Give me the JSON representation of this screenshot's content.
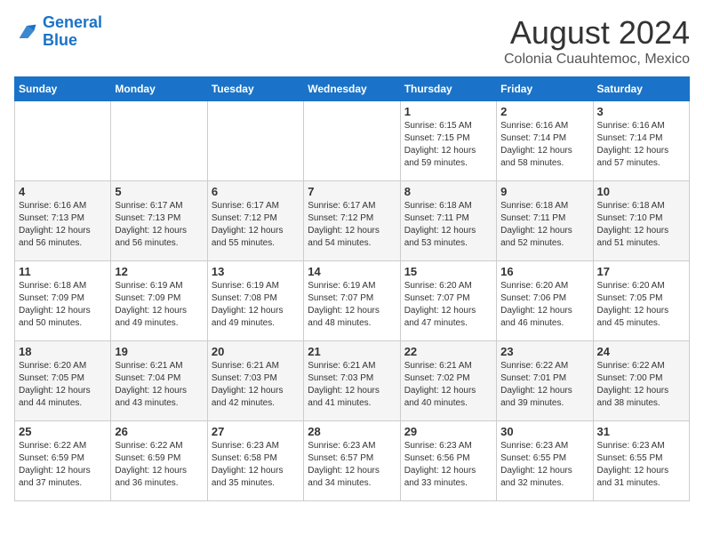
{
  "logo": {
    "line1": "General",
    "line2": "Blue"
  },
  "title": "August 2024",
  "subtitle": "Colonia Cuauhtemoc, Mexico",
  "days_of_week": [
    "Sunday",
    "Monday",
    "Tuesday",
    "Wednesday",
    "Thursday",
    "Friday",
    "Saturday"
  ],
  "weeks": [
    [
      {
        "day": "",
        "info": ""
      },
      {
        "day": "",
        "info": ""
      },
      {
        "day": "",
        "info": ""
      },
      {
        "day": "",
        "info": ""
      },
      {
        "day": "1",
        "info": "Sunrise: 6:15 AM\nSunset: 7:15 PM\nDaylight: 12 hours\nand 59 minutes."
      },
      {
        "day": "2",
        "info": "Sunrise: 6:16 AM\nSunset: 7:14 PM\nDaylight: 12 hours\nand 58 minutes."
      },
      {
        "day": "3",
        "info": "Sunrise: 6:16 AM\nSunset: 7:14 PM\nDaylight: 12 hours\nand 57 minutes."
      }
    ],
    [
      {
        "day": "4",
        "info": "Sunrise: 6:16 AM\nSunset: 7:13 PM\nDaylight: 12 hours\nand 56 minutes."
      },
      {
        "day": "5",
        "info": "Sunrise: 6:17 AM\nSunset: 7:13 PM\nDaylight: 12 hours\nand 56 minutes."
      },
      {
        "day": "6",
        "info": "Sunrise: 6:17 AM\nSunset: 7:12 PM\nDaylight: 12 hours\nand 55 minutes."
      },
      {
        "day": "7",
        "info": "Sunrise: 6:17 AM\nSunset: 7:12 PM\nDaylight: 12 hours\nand 54 minutes."
      },
      {
        "day": "8",
        "info": "Sunrise: 6:18 AM\nSunset: 7:11 PM\nDaylight: 12 hours\nand 53 minutes."
      },
      {
        "day": "9",
        "info": "Sunrise: 6:18 AM\nSunset: 7:11 PM\nDaylight: 12 hours\nand 52 minutes."
      },
      {
        "day": "10",
        "info": "Sunrise: 6:18 AM\nSunset: 7:10 PM\nDaylight: 12 hours\nand 51 minutes."
      }
    ],
    [
      {
        "day": "11",
        "info": "Sunrise: 6:18 AM\nSunset: 7:09 PM\nDaylight: 12 hours\nand 50 minutes."
      },
      {
        "day": "12",
        "info": "Sunrise: 6:19 AM\nSunset: 7:09 PM\nDaylight: 12 hours\nand 49 minutes."
      },
      {
        "day": "13",
        "info": "Sunrise: 6:19 AM\nSunset: 7:08 PM\nDaylight: 12 hours\nand 49 minutes."
      },
      {
        "day": "14",
        "info": "Sunrise: 6:19 AM\nSunset: 7:07 PM\nDaylight: 12 hours\nand 48 minutes."
      },
      {
        "day": "15",
        "info": "Sunrise: 6:20 AM\nSunset: 7:07 PM\nDaylight: 12 hours\nand 47 minutes."
      },
      {
        "day": "16",
        "info": "Sunrise: 6:20 AM\nSunset: 7:06 PM\nDaylight: 12 hours\nand 46 minutes."
      },
      {
        "day": "17",
        "info": "Sunrise: 6:20 AM\nSunset: 7:05 PM\nDaylight: 12 hours\nand 45 minutes."
      }
    ],
    [
      {
        "day": "18",
        "info": "Sunrise: 6:20 AM\nSunset: 7:05 PM\nDaylight: 12 hours\nand 44 minutes."
      },
      {
        "day": "19",
        "info": "Sunrise: 6:21 AM\nSunset: 7:04 PM\nDaylight: 12 hours\nand 43 minutes."
      },
      {
        "day": "20",
        "info": "Sunrise: 6:21 AM\nSunset: 7:03 PM\nDaylight: 12 hours\nand 42 minutes."
      },
      {
        "day": "21",
        "info": "Sunrise: 6:21 AM\nSunset: 7:03 PM\nDaylight: 12 hours\nand 41 minutes."
      },
      {
        "day": "22",
        "info": "Sunrise: 6:21 AM\nSunset: 7:02 PM\nDaylight: 12 hours\nand 40 minutes."
      },
      {
        "day": "23",
        "info": "Sunrise: 6:22 AM\nSunset: 7:01 PM\nDaylight: 12 hours\nand 39 minutes."
      },
      {
        "day": "24",
        "info": "Sunrise: 6:22 AM\nSunset: 7:00 PM\nDaylight: 12 hours\nand 38 minutes."
      }
    ],
    [
      {
        "day": "25",
        "info": "Sunrise: 6:22 AM\nSunset: 6:59 PM\nDaylight: 12 hours\nand 37 minutes."
      },
      {
        "day": "26",
        "info": "Sunrise: 6:22 AM\nSunset: 6:59 PM\nDaylight: 12 hours\nand 36 minutes."
      },
      {
        "day": "27",
        "info": "Sunrise: 6:23 AM\nSunset: 6:58 PM\nDaylight: 12 hours\nand 35 minutes."
      },
      {
        "day": "28",
        "info": "Sunrise: 6:23 AM\nSunset: 6:57 PM\nDaylight: 12 hours\nand 34 minutes."
      },
      {
        "day": "29",
        "info": "Sunrise: 6:23 AM\nSunset: 6:56 PM\nDaylight: 12 hours\nand 33 minutes."
      },
      {
        "day": "30",
        "info": "Sunrise: 6:23 AM\nSunset: 6:55 PM\nDaylight: 12 hours\nand 32 minutes."
      },
      {
        "day": "31",
        "info": "Sunrise: 6:23 AM\nSunset: 6:55 PM\nDaylight: 12 hours\nand 31 minutes."
      }
    ]
  ]
}
